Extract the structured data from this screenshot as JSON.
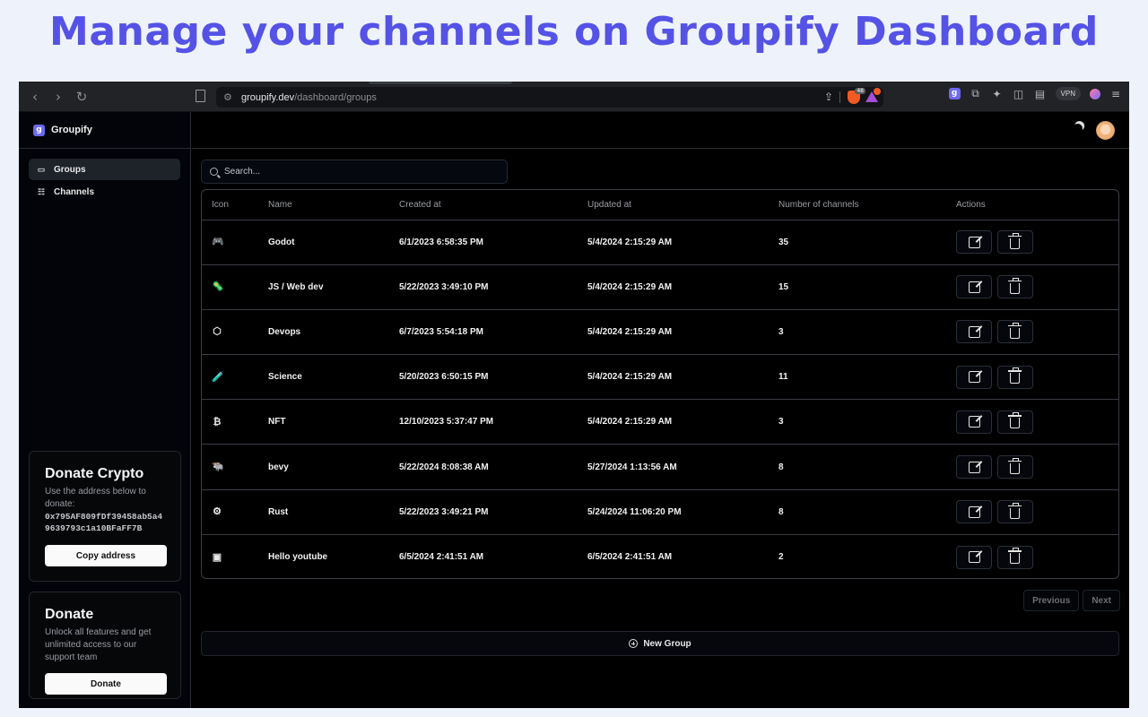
{
  "headline": "Manage your channels on Groupify Dashboard",
  "browser": {
    "url_host": "groupify.dev",
    "url_path": "/dashboard/groups",
    "brave_badge": "48",
    "vpn_label": "VPN"
  },
  "app": {
    "brand_name": "Groupify",
    "brand_logo_letter": "g"
  },
  "sidebar": {
    "items": [
      {
        "label": "Groups",
        "icon": "video-icon",
        "active": true
      },
      {
        "label": "Channels",
        "icon": "list-icon",
        "active": false
      }
    ]
  },
  "donate_crypto": {
    "title": "Donate Crypto",
    "text": "Use the address below to donate:",
    "address": "0x795AF809fDf39458ab5a49639793c1a10BFaFF7B",
    "button": "Copy address"
  },
  "donate": {
    "title": "Donate",
    "text": "Unlock all features and get unlimited access to our support team",
    "button": "Donate"
  },
  "search": {
    "placeholder": "Search..."
  },
  "table": {
    "headers": {
      "icon": "Icon",
      "name": "Name",
      "created": "Created at",
      "updated": "Updated at",
      "count": "Number of channels",
      "actions": "Actions"
    },
    "rows": [
      {
        "icon": "🎮",
        "name": "Godot",
        "created": "6/1/2023 6:58:35 PM",
        "updated": "5/4/2024 2:15:29 AM",
        "count": "35"
      },
      {
        "icon": "🦠",
        "name": "JS / Web dev",
        "created": "5/22/2023 3:49:10 PM",
        "updated": "5/4/2024 2:15:29 AM",
        "count": "15"
      },
      {
        "icon": "⬡",
        "name": "Devops",
        "created": "6/7/2023 5:54:18 PM",
        "updated": "5/4/2024 2:15:29 AM",
        "count": "3"
      },
      {
        "icon": "🧪",
        "name": "Science",
        "created": "5/20/2023 6:50:15 PM",
        "updated": "5/4/2024 2:15:29 AM",
        "count": "11"
      },
      {
        "icon": "₿",
        "name": "NFT",
        "created": "12/10/2023 5:37:47 PM",
        "updated": "5/4/2024 2:15:29 AM",
        "count": "3"
      },
      {
        "icon": "🐃",
        "name": "bevy",
        "created": "5/22/2024 8:08:38 AM",
        "updated": "5/27/2024 1:13:56 AM",
        "count": "8"
      },
      {
        "icon": "⚙",
        "name": "Rust",
        "created": "5/22/2023 3:49:21 PM",
        "updated": "5/24/2024 11:06:20 PM",
        "count": "8"
      },
      {
        "icon": "▣",
        "name": "Hello youtube",
        "created": "6/5/2024 2:41:51 AM",
        "updated": "6/5/2024 2:41:51 AM",
        "count": "2"
      }
    ]
  },
  "pager": {
    "previous": "Previous",
    "next": "Next"
  },
  "new_group": "New Group"
}
